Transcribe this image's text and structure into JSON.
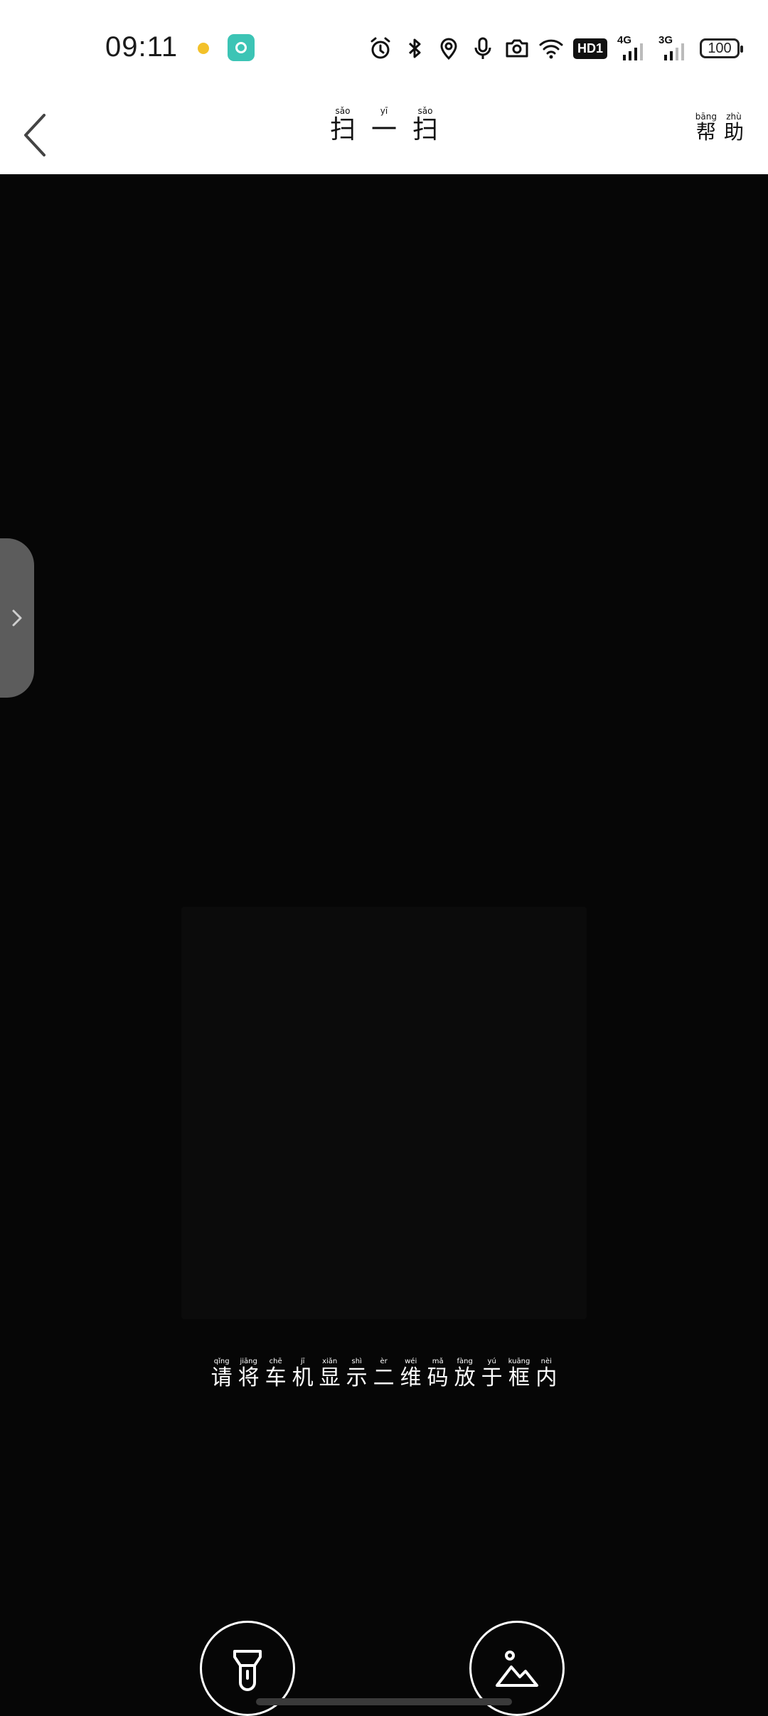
{
  "status_bar": {
    "time": "09:11",
    "hd_label": "HD1",
    "network_1": "4G",
    "network_2": "3G",
    "battery": "100",
    "icons": [
      "emoji-notification-icon",
      "app-notification-icon",
      "alarm-icon",
      "bluetooth-icon",
      "location-icon",
      "microphone-icon",
      "camera-icon",
      "wifi-icon"
    ]
  },
  "header": {
    "title": [
      {
        "py": "sǎo",
        "hz": "扫"
      },
      {
        "py": "yī",
        "hz": "一"
      },
      {
        "py": "sǎo",
        "hz": "扫"
      }
    ],
    "help": [
      {
        "py": "bāng",
        "hz": "帮"
      },
      {
        "py": "zhù",
        "hz": "助"
      }
    ]
  },
  "scanner": {
    "hint": [
      {
        "py": "qǐng",
        "hz": "请"
      },
      {
        "py": "jiāng",
        "hz": "将"
      },
      {
        "py": "chē",
        "hz": "车"
      },
      {
        "py": "jī",
        "hz": "机"
      },
      {
        "py": "xiǎn",
        "hz": "显"
      },
      {
        "py": "shì",
        "hz": "示"
      },
      {
        "py": "èr",
        "hz": "二"
      },
      {
        "py": "wéi",
        "hz": "维"
      },
      {
        "py": "mǎ",
        "hz": "码"
      },
      {
        "py": "fàng",
        "hz": "放"
      },
      {
        "py": "yú",
        "hz": "于"
      },
      {
        "py": "kuāng",
        "hz": "框"
      },
      {
        "py": "nèi",
        "hz": "内"
      }
    ]
  },
  "buttons": {
    "torch_icon": "flashlight-icon",
    "album_icon": "image-gallery-icon"
  }
}
